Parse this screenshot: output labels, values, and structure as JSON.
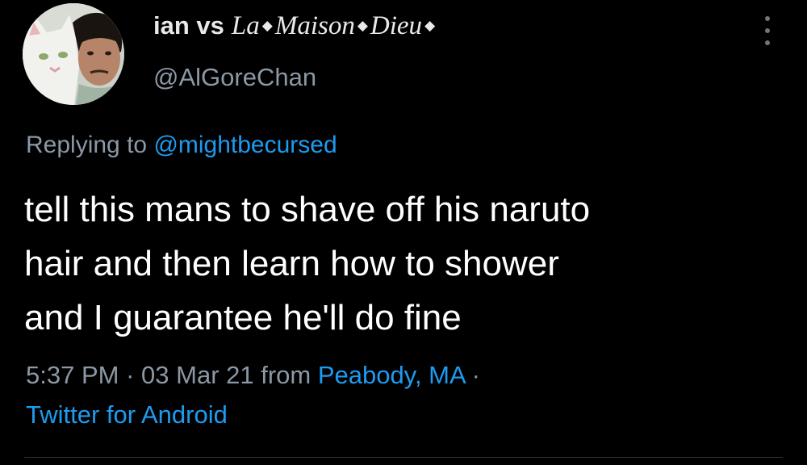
{
  "tweet": {
    "display_name_prefix": "ian vs",
    "display_name_fancy": [
      "La",
      "Maison",
      "Dieu"
    ],
    "diamond_glyph": "◆",
    "handle": "@AlGoreChan",
    "reply_prefix": "Replying to",
    "reply_mention": "@mightbecursed",
    "body_lines": [
      "tell this mans to shave off his naruto",
      "hair and then learn how to shower",
      "and I guarantee he'll do fine"
    ],
    "time": "5:37 PM",
    "separator": "·",
    "date": "03 Mar 21",
    "from_label": "from",
    "location": "Peabody, MA",
    "client": "Twitter for Android"
  },
  "colors": {
    "background": "#000000",
    "primary_text": "#ffffff",
    "secondary_text": "#8b98a5",
    "link": "#1d9bf0"
  },
  "icons": {
    "more": "more-vertical-icon",
    "avatar": "profile-photo-man-with-white-cat"
  }
}
